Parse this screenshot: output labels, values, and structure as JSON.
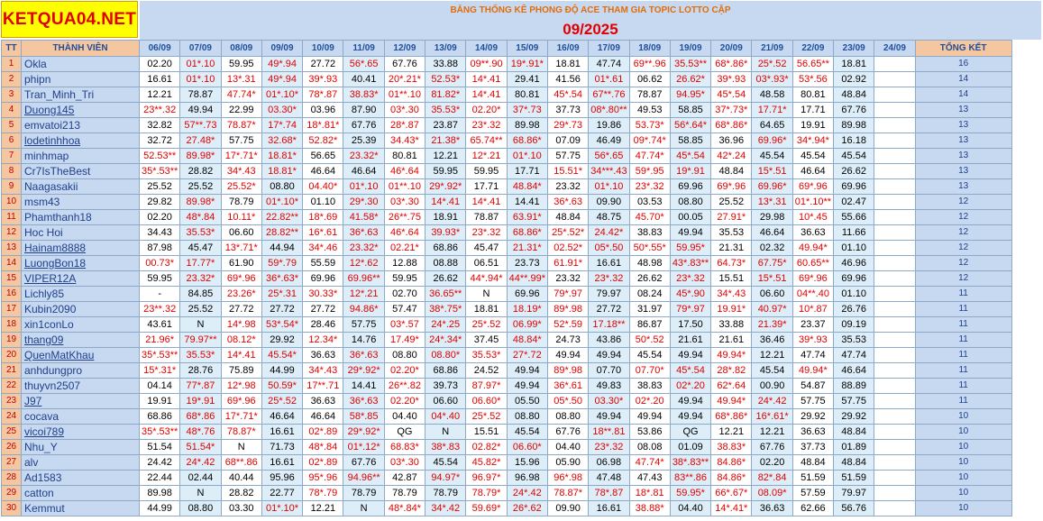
{
  "logo": "KETQUA04.NET",
  "title": "BẢNG THỐNG KÊ PHONG ĐỘ ACE THAM GIA TOPIC  LOTTO CẶP",
  "month": "09/2025",
  "headers": {
    "tt": "TT",
    "member": "THÀNH VIÊN",
    "total": "TỔNG KẾT"
  },
  "dates": [
    "06/09",
    "07/09",
    "08/09",
    "09/09",
    "10/09",
    "11/09",
    "12/09",
    "13/09",
    "14/09",
    "15/09",
    "16/09",
    "17/09",
    "18/09",
    "19/09",
    "20/09",
    "21/09",
    "22/09",
    "23/09",
    "24/09"
  ],
  "rows": [
    {
      "tt": "1",
      "name": "Okla",
      "cells": [
        "02.20",
        "01*.10",
        "59.95",
        "49*.94",
        "27.72",
        "56*.65",
        "67.76",
        "33.88",
        "09**.90",
        "19*.91*",
        "18.81",
        "47.74",
        "69**.96",
        "35.53**",
        "68*.86*",
        "25*.52",
        "56.65**",
        "18.81",
        ""
      ],
      "total": "16"
    },
    {
      "tt": "2",
      "name": "phipn",
      "cells": [
        "16.61",
        "01*.10",
        "13*.31",
        "49*.94",
        "39*.93",
        "40.41",
        "20*.21*",
        "52.53*",
        "14*.41",
        "29.41",
        "41.56",
        "01*.61",
        "06.62",
        "26.62*",
        "39*.93",
        "03*.93*",
        "53*.56",
        "02.92",
        ""
      ],
      "total": "14"
    },
    {
      "tt": "3",
      "name": "Tran_Minh_Tri",
      "cells": [
        "12.21",
        "78.87",
        "47.74*",
        "01*.10*",
        "78*.87",
        "38.83*",
        "01**.10",
        "81.82*",
        "14*.41",
        "80.81",
        "45*.54",
        "67**.76",
        "78.87",
        "94.95*",
        "45*.54",
        "48.58",
        "80.81",
        "48.84",
        ""
      ],
      "total": "14"
    },
    {
      "tt": "4",
      "name": "Duong145",
      "cells": [
        "23**.32",
        "49.94",
        "22.99",
        "03.30*",
        "03.96",
        "87.90",
        "03*.30",
        "35.53*",
        "02.20*",
        "37*.73",
        "37.73",
        "08*.80**",
        "49.53",
        "58.85",
        "37*.73*",
        "17.71*",
        "17.71",
        "67.76",
        ""
      ],
      "total": "13"
    },
    {
      "tt": "5",
      "name": "emvatoi213",
      "cells": [
        "32.82",
        "57**.73",
        "78.87*",
        "17*.74",
        "18*.81*",
        "67.76",
        "28*.87",
        "23.87",
        "23*.32",
        "89.98",
        "29*.73",
        "19.86",
        "53.73*",
        "56*.64*",
        "68*.86*",
        "64.65",
        "19.91",
        "89.98",
        ""
      ],
      "total": "13"
    },
    {
      "tt": "6",
      "name": "lodetinhhoa",
      "cells": [
        "32.72",
        "27.48*",
        "57.75",
        "32.68*",
        "52.82*",
        "25.39",
        "34.43*",
        "21.38*",
        "65.74**",
        "68.86*",
        "07.09",
        "46.49",
        "09*.74*",
        "58.85",
        "36.96",
        "69.96*",
        "34*.94*",
        "16.18",
        ""
      ],
      "total": "13"
    },
    {
      "tt": "7",
      "name": "minhmap",
      "cells": [
        "52.53**",
        "89.98*",
        "17*.71*",
        "18.81*",
        "56.65",
        "23.32*",
        "80.81",
        "12.21",
        "12*.21",
        "01*.10",
        "57.75",
        "56*.65",
        "47.74*",
        "45*.54",
        "42*.24",
        "45.54",
        "45.54",
        "45.54",
        ""
      ],
      "total": "13"
    },
    {
      "tt": "8",
      "name": "Cr7IsTheBest",
      "cells": [
        "35*.53**",
        "28.82",
        "34*.43",
        "18.81*",
        "46.64",
        "46.64",
        "46*.64",
        "59.95",
        "59.95",
        "17.71",
        "15.51*",
        "34***.43",
        "59*.95",
        "19*.91",
        "48.84",
        "15*.51",
        "46.64",
        "26.62",
        ""
      ],
      "total": "13"
    },
    {
      "tt": "9",
      "name": "Naagasakii",
      "cells": [
        "25.52",
        "25.52",
        "25.52*",
        "08.80",
        "04.40*",
        "01*.10",
        "01**.10",
        "29*.92*",
        "17.71",
        "48.84*",
        "23.32",
        "01*.10",
        "23*.32",
        "69.96",
        "69*.96",
        "69.96*",
        "69*.96",
        "69.96",
        ""
      ],
      "total": "13"
    },
    {
      "tt": "10",
      "name": "msm43",
      "cells": [
        "29.82",
        "89.98*",
        "78.79",
        "01*.10*",
        "01.10",
        "29*.30",
        "03*.30",
        "14*.41",
        "14*.41",
        "14.41",
        "36*.63",
        "09.90",
        "03.53",
        "08.80",
        "25.52",
        "13*.31",
        "01*.10**",
        "02.47",
        ""
      ],
      "total": "12"
    },
    {
      "tt": "11",
      "name": "Phamthanh18",
      "cells": [
        "02.20",
        "48*.84",
        "10.11*",
        "22.82**",
        "18*.69",
        "41.58*",
        "26**.75",
        "18.91",
        "78.87",
        "63.91*",
        "48.84",
        "48.75",
        "45.70*",
        "00.05",
        "27.91*",
        "29.98",
        "10*.45",
        "55.66",
        ""
      ],
      "total": "12"
    },
    {
      "tt": "12",
      "name": "Hoc Hoi",
      "cells": [
        "34.43",
        "35.53*",
        "06.60",
        "28.82**",
        "16*.61",
        "36*.63",
        "46*.64",
        "39.93*",
        "23*.32",
        "68.86*",
        "25*.52*",
        "24.42*",
        "38.83",
        "49.94",
        "35.53",
        "46.64",
        "36.63",
        "11.66",
        ""
      ],
      "total": "12"
    },
    {
      "tt": "13",
      "name": "Hainam8888",
      "cells": [
        "87.98",
        "45.47",
        "13*.71*",
        "44.94",
        "34*.46",
        "23.32*",
        "02.21*",
        "68.86",
        "45.47",
        "21.31*",
        "02.52*",
        "05*.50",
        "50*.55*",
        "59.95*",
        "21.31",
        "02.32",
        "49.94*",
        "01.10",
        ""
      ],
      "total": "12"
    },
    {
      "tt": "14",
      "name": "LuongBon18",
      "cells": [
        "00.73*",
        "17.77*",
        "61.90",
        "59*.79",
        "55.59",
        "12*.62",
        "12.88",
        "08.88",
        "06.51",
        "23.73",
        "61.91*",
        "16.61",
        "48.98",
        "43*.83**",
        "64.73*",
        "67.75*",
        "60.65**",
        "46.96",
        ""
      ],
      "total": "12"
    },
    {
      "tt": "15",
      "name": "VIPER12A",
      "cells": [
        "59.95",
        "23.32*",
        "69*.96",
        "36*.63*",
        "69.96",
        "69.96**",
        "59.95",
        "26.62",
        "44*.94*",
        "44**.99*",
        "23.32",
        "23*.32",
        "26.62",
        "23*.32",
        "15.51",
        "15*.51",
        "69*.96",
        "69.96",
        ""
      ],
      "total": "12"
    },
    {
      "tt": "16",
      "name": "Lichly85",
      "cells": [
        "-",
        "84.85",
        "23.26*",
        "25*.31",
        "30.33*",
        "12*.21",
        "02.70",
        "36.65**",
        "N",
        "69.96",
        "79*.97",
        "79.97",
        "08.24",
        "45*.90",
        "34*.43",
        "06.60",
        "04**.40",
        "01.10",
        ""
      ],
      "total": "11"
    },
    {
      "tt": "17",
      "name": "Kubin2090",
      "cells": [
        "23**.32",
        "25.52",
        "27.72",
        "27.72",
        "27.72",
        "94.86*",
        "57.47",
        "38*.75*",
        "18.81",
        "18.19*",
        "89*.98",
        "27.72",
        "31.97",
        "79*.97",
        "19.91*",
        "40.97*",
        "10*.87",
        "26.76",
        ""
      ],
      "total": "11"
    },
    {
      "tt": "18",
      "name": "xin1conLo",
      "cells": [
        "43.61",
        "N",
        "14*.98",
        "53*.54*",
        "28.46",
        "57.75",
        "03*.57",
        "24*.25",
        "25*.52",
        "06.99*",
        "52*.59",
        "17.18**",
        "86.87",
        "17.50",
        "33.88",
        "21.39*",
        "23.37",
        "09.19",
        ""
      ],
      "total": "11"
    },
    {
      "tt": "19",
      "name": "thang09",
      "cells": [
        "21.96*",
        "79.97**",
        "08.12*",
        "29.92",
        "12.34*",
        "14.76",
        "17.49*",
        "24*.34*",
        "37.45",
        "48.84*",
        "24.73",
        "43.86",
        "50*.52",
        "21.61",
        "21.61",
        "36.46",
        "39*.93",
        "35.53",
        ""
      ],
      "total": "11"
    },
    {
      "tt": "20",
      "name": "QuenMatKhau",
      "cells": [
        "35*.53**",
        "35.53*",
        "14*.41",
        "45.54*",
        "36.63",
        "36*.63",
        "08.80",
        "08.80*",
        "35.53*",
        "27*.72",
        "49.94",
        "49.94",
        "45.54",
        "49.94",
        "49.94*",
        "12.21",
        "47.74",
        "47.74",
        ""
      ],
      "total": "11"
    },
    {
      "tt": "21",
      "name": "anhdungpro",
      "cells": [
        "15*.31*",
        "28.76",
        "75.89",
        "44.99",
        "34*.43",
        "29*.92*",
        "02.20*",
        "68.86",
        "24.52",
        "49.94",
        "89*.98",
        "07.70",
        "07.70*",
        "45*.54",
        "28*.82",
        "45.54",
        "49.94*",
        "46.64",
        ""
      ],
      "total": "11"
    },
    {
      "tt": "22",
      "name": "thuyvn2507",
      "cells": [
        "04.14",
        "77*.87",
        "12*.98",
        "50.59*",
        "17**.71",
        "14.41",
        "26**.82",
        "39.73",
        "87.97*",
        "49.94",
        "36*.61",
        "49.83",
        "38.83",
        "02*.20",
        "62*.64",
        "00.90",
        "54.87",
        "88.89",
        ""
      ],
      "total": "11"
    },
    {
      "tt": "23",
      "name": "J97",
      "cells": [
        "19.91",
        "19*.91",
        "69*.96",
        "25*.52",
        "36.63",
        "36*.63",
        "02.20*",
        "06.60",
        "06.60*",
        "05.50",
        "05*.50",
        "03.30*",
        "02*.20",
        "49.94",
        "49.94*",
        "24*.42",
        "57.75",
        "57.75",
        ""
      ],
      "total": "11"
    },
    {
      "tt": "24",
      "name": "cocava",
      "cells": [
        "68.86",
        "68*.86",
        "17*.71*",
        "46.64",
        "46.64",
        "58*.85",
        "04.40",
        "04*.40",
        "25*.52",
        "08.80",
        "08.80",
        "49.94",
        "49.94",
        "49.94",
        "68*.86*",
        "16*.61*",
        "29.92",
        "29.92",
        ""
      ],
      "total": "10"
    },
    {
      "tt": "25",
      "name": "vicoi789",
      "cells": [
        "35*.53**",
        "48*.76",
        "78.87*",
        "16.61",
        "02*.89",
        "29*.92*",
        "QG",
        "N",
        "15.51",
        "45.54",
        "67.76",
        "18**.81",
        "53.86",
        "QG",
        "12.21",
        "12.21",
        "36.63",
        "48.84",
        ""
      ],
      "total": "10"
    },
    {
      "tt": "26",
      "name": "Nhu_Y",
      "cells": [
        "51.54",
        "51.54*",
        "N",
        "71.73",
        "48*.84",
        "01*.12*",
        "68.83*",
        "38*.83",
        "02.82*",
        "06.60*",
        "04.40",
        "23*.32",
        "08.08",
        "01.09",
        "38.83*",
        "67.76",
        "37.73",
        "01.89",
        ""
      ],
      "total": "10"
    },
    {
      "tt": "27",
      "name": "alv",
      "cells": [
        "24.42",
        "24*.42",
        "68**.86",
        "16.61",
        "02*.89",
        "67.76",
        "03*.30",
        "45.54",
        "45.82*",
        "15.96",
        "05.90",
        "06.98",
        "47.74*",
        "38*.83**",
        "84.86*",
        "02.20",
        "48.84",
        "48.84",
        ""
      ],
      "total": "10"
    },
    {
      "tt": "28",
      "name": "Ad1583",
      "cells": [
        "22.44",
        "02.44",
        "40.44",
        "95.96",
        "95*.96",
        "94.96**",
        "42.87",
        "94.97*",
        "96.97*",
        "96.98",
        "96*.98",
        "47.48",
        "47.43",
        "83**.86",
        "84.86*",
        "82*.84",
        "51.59",
        "51.59",
        ""
      ],
      "total": "10"
    },
    {
      "tt": "29",
      "name": "catton",
      "cells": [
        "89.98",
        "N",
        "28.82",
        "22.77",
        "78*.79",
        "78.79",
        "78.79",
        "78.79",
        "78.79*",
        "24*.42",
        "78.87*",
        "78*.87",
        "18*.81",
        "59.95*",
        "66*.67*",
        "08.09*",
        "57.59",
        "79.97",
        ""
      ],
      "total": "10"
    },
    {
      "tt": "30",
      "name": "Kemmut",
      "cells": [
        "44.99",
        "08.80",
        "03.30",
        "01*.10*",
        "12.21",
        "N",
        "48*.84*",
        "34*.42",
        "59.69*",
        "26*.62",
        "09.90",
        "16.61",
        "38.88*",
        "04.40",
        "14*.41*",
        "36.63",
        "62.66",
        "56.76",
        ""
      ],
      "total": "10"
    }
  ],
  "colors": {
    "logo_bg": "#ffff00",
    "logo_text": "#e00000",
    "header_bg": "#c6d9f0",
    "rank_bg": "#f4c7a0",
    "hit": "#e00000",
    "band": "#ddeef8"
  }
}
